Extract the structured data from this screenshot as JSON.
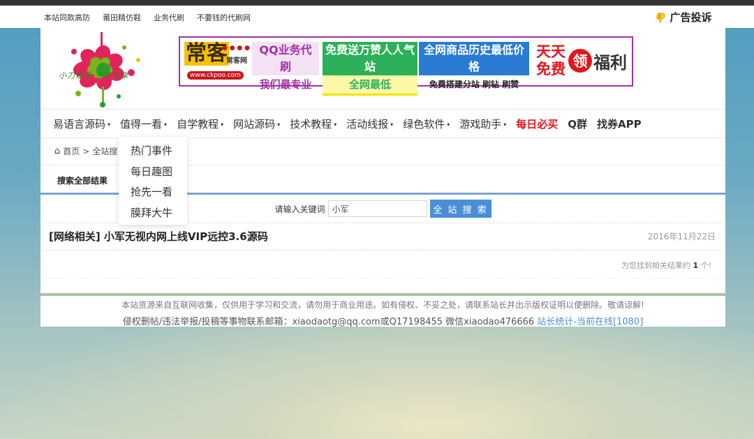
{
  "topbar": {
    "links": [
      "本站同款高防",
      "莆田精仿鞋",
      "业务代刷",
      "不要钱的代刷网"
    ],
    "complaint": "广告投诉"
  },
  "logo": {
    "text": "小刀娱乐 乐于分享"
  },
  "banner": {
    "brand": "常客",
    "brand_sub": "常客网",
    "brand_url": "www.ckpoo.com",
    "block1": [
      "QQ业务代刷",
      "我们最专业"
    ],
    "block2": [
      "免费送万赞人人气站",
      "全网最低"
    ],
    "block3": [
      "全网商品历史最低价格",
      "免费搭建分站 刷钻 刷赞"
    ],
    "block4": [
      "天天",
      "免费"
    ],
    "block5": "领",
    "block6": "福利"
  },
  "nav": {
    "items": [
      {
        "label": "易语言源码",
        "dropdown": true
      },
      {
        "label": "值得一看",
        "dropdown": true
      },
      {
        "label": "自学教程",
        "dropdown": true
      },
      {
        "label": "网站源码",
        "dropdown": true
      },
      {
        "label": "技术教程",
        "dropdown": true
      },
      {
        "label": "活动线报",
        "dropdown": true
      },
      {
        "label": "绿色软件",
        "dropdown": true
      },
      {
        "label": "游戏助手",
        "dropdown": true
      },
      {
        "label": "每日必买",
        "dropdown": false
      },
      {
        "label": "Q群",
        "dropdown": false
      },
      {
        "label": "找券APP",
        "dropdown": false
      }
    ],
    "caret": "▾"
  },
  "breadcrumb": {
    "home": "首页",
    "sep": ">",
    "current": "全站搜"
  },
  "tab": {
    "label": "搜索全部结果"
  },
  "search": {
    "label": "请输入关键词",
    "value": "小军",
    "button": "全 站 搜 索"
  },
  "result": {
    "title": "[网络相关] 小军无视内网上线VIP远控3.6源码",
    "date": "2016年11月22日"
  },
  "count": {
    "prefix": "为您找到相关结果约 ",
    "number": "1",
    "suffix": " 个!"
  },
  "footer": {
    "line1": "本站资源来自互联网收集，仅供用于学习和交流，请勿用于商业用途。如有侵权、不妥之处，请联系站长并出示版权证明以便删除。敬请谅解!",
    "line2": "侵权删帖/违法举报/投稿等事物联系邮箱：xiaodaotg@qq.com或Q17198455 微信xiaodao476666 ",
    "link": "站长统计-当前在线[1080]"
  },
  "dropdown": {
    "items": [
      "热门事件",
      "每日趣图",
      "抢先一看",
      "膜拜大牛"
    ]
  },
  "colors": {
    "accent_blue": "#4a8fd6",
    "red": "#e4151d",
    "purple": "#a231a8",
    "green": "#2db05a"
  }
}
